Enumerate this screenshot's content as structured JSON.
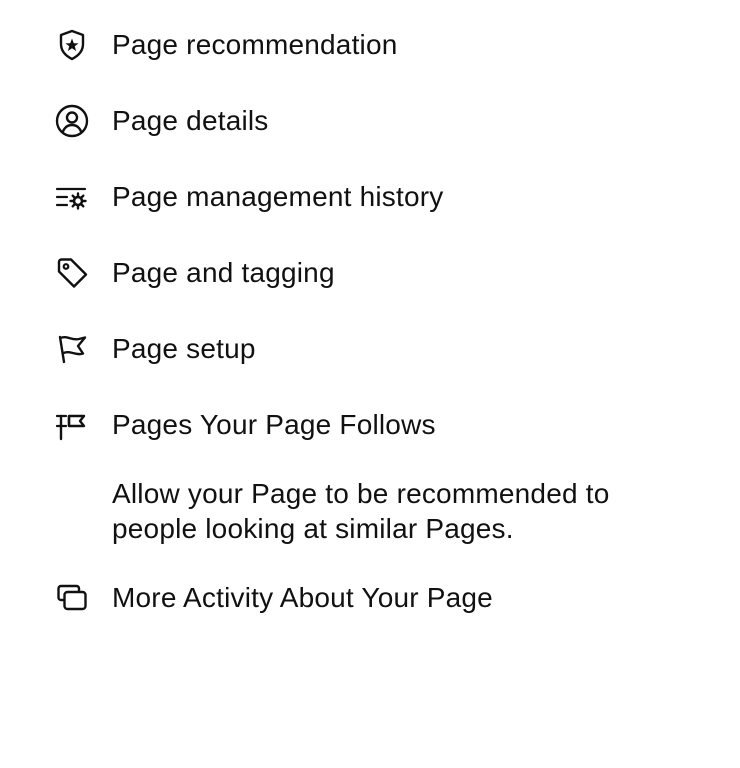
{
  "menu": {
    "items": [
      {
        "label": "Page recommendation",
        "icon": "shield-star-icon"
      },
      {
        "label": "Page details",
        "icon": "user-circle-icon"
      },
      {
        "label": "Page management history",
        "icon": "list-gear-icon"
      },
      {
        "label": "Page and tagging",
        "icon": "tag-icon"
      },
      {
        "label": "Page setup",
        "icon": "flag-icon"
      },
      {
        "label": "Pages Your Page Follows",
        "icon": "flag-post-icon"
      }
    ],
    "description": {
      "line1": "Allow your Page to be recommended to",
      "line2": "people looking at similar Pages."
    },
    "more_activity": {
      "label": "More Activity About Your Page",
      "icon": "stacked-squares-icon"
    }
  }
}
